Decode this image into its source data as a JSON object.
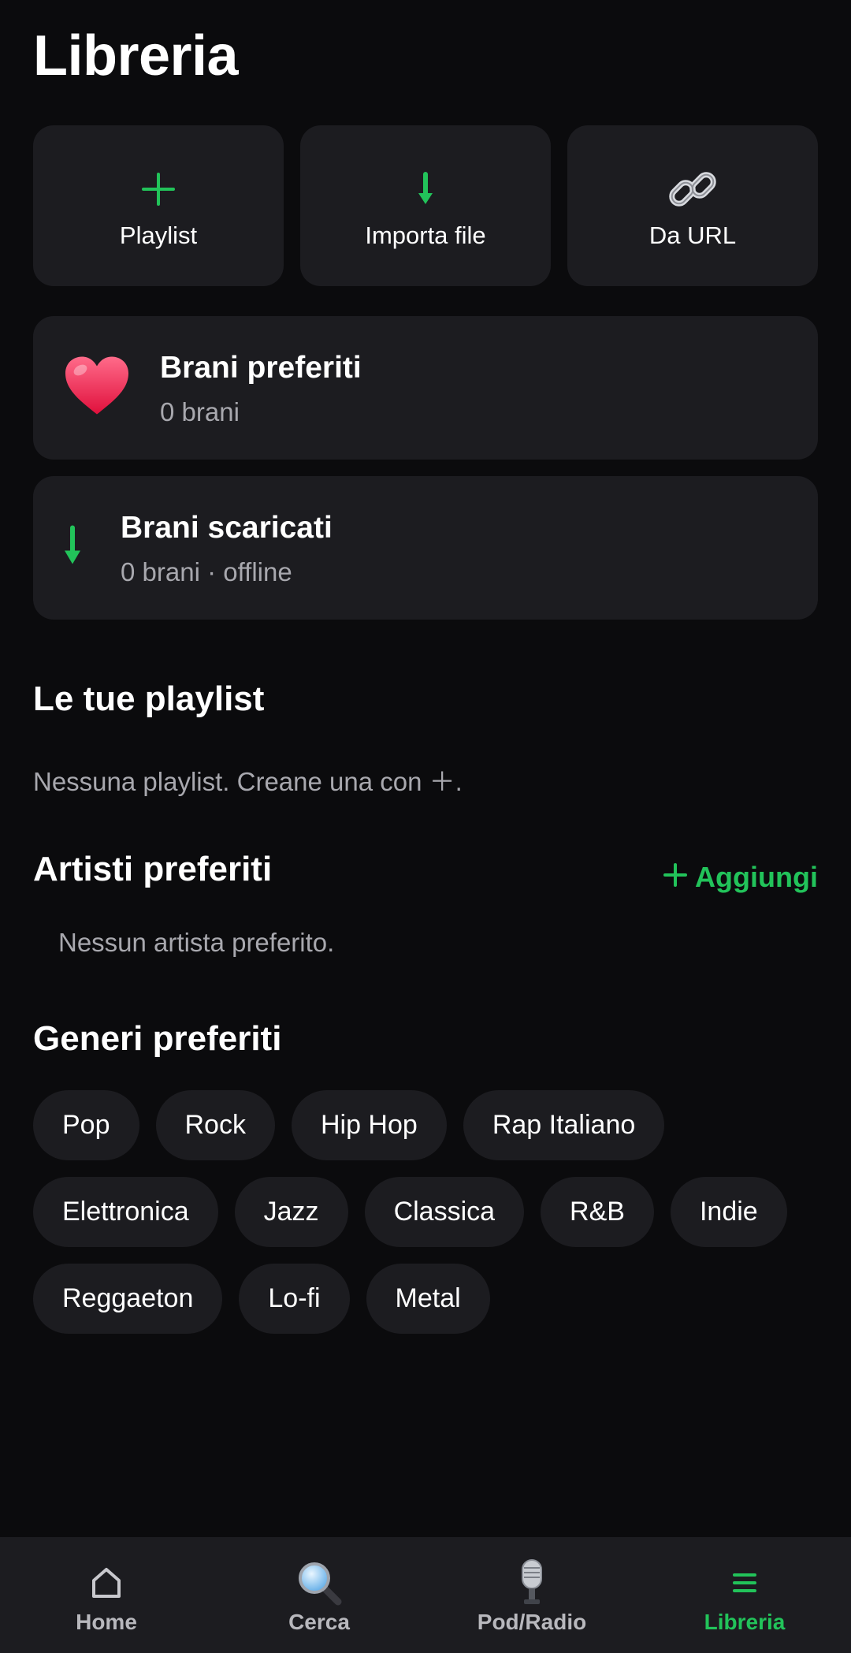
{
  "header": {
    "title": "Libreria"
  },
  "actions": [
    {
      "label": "Playlist",
      "icon": "plus-icon"
    },
    {
      "label": "Importa file",
      "icon": "download-arrow-icon"
    },
    {
      "label": "Da URL",
      "icon": "link-icon"
    }
  ],
  "favorites_card": {
    "title": "Brani preferiti",
    "subtitle": "0 brani",
    "icon": "heart-icon"
  },
  "downloads_card": {
    "title": "Brani scaricati",
    "subtitle": "0 brani · offline",
    "icon": "download-arrow-icon"
  },
  "playlists_section": {
    "title": "Le tue playlist",
    "empty_text": "Nessuna playlist. Creane una con ＋."
  },
  "artists_section": {
    "title": "Artisti preferiti",
    "add_label": "Aggiungi",
    "empty_text": "Nessun artista preferito."
  },
  "genres_section": {
    "title": "Generi preferiti",
    "rows": [
      [
        "Pop",
        "Rock",
        "Hip Hop",
        "Rap Italiano"
      ],
      [
        "Elettronica",
        "Jazz",
        "Classica",
        "R&B",
        "Indie"
      ],
      [
        "Reggaeton",
        "Lo-fi",
        "Metal"
      ]
    ]
  },
  "nav": [
    {
      "label": "Home",
      "icon": "home-icon",
      "active": false
    },
    {
      "label": "Cerca",
      "icon": "search-icon",
      "active": false
    },
    {
      "label": "Pod/Radio",
      "icon": "microphone-icon",
      "active": false
    },
    {
      "label": "Libreria",
      "icon": "library-icon",
      "active": true
    }
  ],
  "colors": {
    "background": "#0b0b0d",
    "card": "#1c1c20",
    "accent": "#22c35a",
    "muted": "#a8a8ae"
  }
}
